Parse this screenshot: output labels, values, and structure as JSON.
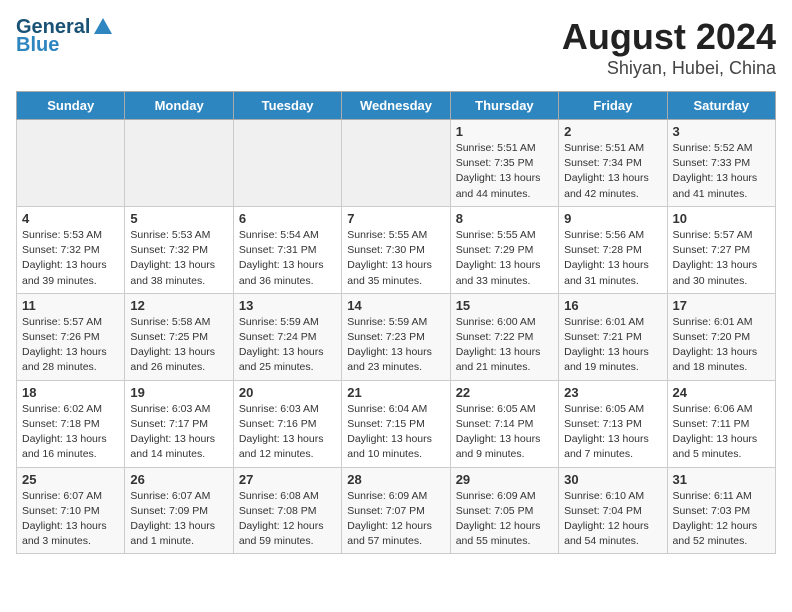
{
  "header": {
    "logo_line1": "General",
    "logo_line2": "Blue",
    "month_year": "August 2024",
    "location": "Shiyan, Hubei, China"
  },
  "days_of_week": [
    "Sunday",
    "Monday",
    "Tuesday",
    "Wednesday",
    "Thursday",
    "Friday",
    "Saturday"
  ],
  "weeks": [
    [
      {
        "day": "",
        "info": ""
      },
      {
        "day": "",
        "info": ""
      },
      {
        "day": "",
        "info": ""
      },
      {
        "day": "",
        "info": ""
      },
      {
        "day": "1",
        "info": "Sunrise: 5:51 AM\nSunset: 7:35 PM\nDaylight: 13 hours\nand 44 minutes."
      },
      {
        "day": "2",
        "info": "Sunrise: 5:51 AM\nSunset: 7:34 PM\nDaylight: 13 hours\nand 42 minutes."
      },
      {
        "day": "3",
        "info": "Sunrise: 5:52 AM\nSunset: 7:33 PM\nDaylight: 13 hours\nand 41 minutes."
      }
    ],
    [
      {
        "day": "4",
        "info": "Sunrise: 5:53 AM\nSunset: 7:32 PM\nDaylight: 13 hours\nand 39 minutes."
      },
      {
        "day": "5",
        "info": "Sunrise: 5:53 AM\nSunset: 7:32 PM\nDaylight: 13 hours\nand 38 minutes."
      },
      {
        "day": "6",
        "info": "Sunrise: 5:54 AM\nSunset: 7:31 PM\nDaylight: 13 hours\nand 36 minutes."
      },
      {
        "day": "7",
        "info": "Sunrise: 5:55 AM\nSunset: 7:30 PM\nDaylight: 13 hours\nand 35 minutes."
      },
      {
        "day": "8",
        "info": "Sunrise: 5:55 AM\nSunset: 7:29 PM\nDaylight: 13 hours\nand 33 minutes."
      },
      {
        "day": "9",
        "info": "Sunrise: 5:56 AM\nSunset: 7:28 PM\nDaylight: 13 hours\nand 31 minutes."
      },
      {
        "day": "10",
        "info": "Sunrise: 5:57 AM\nSunset: 7:27 PM\nDaylight: 13 hours\nand 30 minutes."
      }
    ],
    [
      {
        "day": "11",
        "info": "Sunrise: 5:57 AM\nSunset: 7:26 PM\nDaylight: 13 hours\nand 28 minutes."
      },
      {
        "day": "12",
        "info": "Sunrise: 5:58 AM\nSunset: 7:25 PM\nDaylight: 13 hours\nand 26 minutes."
      },
      {
        "day": "13",
        "info": "Sunrise: 5:59 AM\nSunset: 7:24 PM\nDaylight: 13 hours\nand 25 minutes."
      },
      {
        "day": "14",
        "info": "Sunrise: 5:59 AM\nSunset: 7:23 PM\nDaylight: 13 hours\nand 23 minutes."
      },
      {
        "day": "15",
        "info": "Sunrise: 6:00 AM\nSunset: 7:22 PM\nDaylight: 13 hours\nand 21 minutes."
      },
      {
        "day": "16",
        "info": "Sunrise: 6:01 AM\nSunset: 7:21 PM\nDaylight: 13 hours\nand 19 minutes."
      },
      {
        "day": "17",
        "info": "Sunrise: 6:01 AM\nSunset: 7:20 PM\nDaylight: 13 hours\nand 18 minutes."
      }
    ],
    [
      {
        "day": "18",
        "info": "Sunrise: 6:02 AM\nSunset: 7:18 PM\nDaylight: 13 hours\nand 16 minutes."
      },
      {
        "day": "19",
        "info": "Sunrise: 6:03 AM\nSunset: 7:17 PM\nDaylight: 13 hours\nand 14 minutes."
      },
      {
        "day": "20",
        "info": "Sunrise: 6:03 AM\nSunset: 7:16 PM\nDaylight: 13 hours\nand 12 minutes."
      },
      {
        "day": "21",
        "info": "Sunrise: 6:04 AM\nSunset: 7:15 PM\nDaylight: 13 hours\nand 10 minutes."
      },
      {
        "day": "22",
        "info": "Sunrise: 6:05 AM\nSunset: 7:14 PM\nDaylight: 13 hours\nand 9 minutes."
      },
      {
        "day": "23",
        "info": "Sunrise: 6:05 AM\nSunset: 7:13 PM\nDaylight: 13 hours\nand 7 minutes."
      },
      {
        "day": "24",
        "info": "Sunrise: 6:06 AM\nSunset: 7:11 PM\nDaylight: 13 hours\nand 5 minutes."
      }
    ],
    [
      {
        "day": "25",
        "info": "Sunrise: 6:07 AM\nSunset: 7:10 PM\nDaylight: 13 hours\nand 3 minutes."
      },
      {
        "day": "26",
        "info": "Sunrise: 6:07 AM\nSunset: 7:09 PM\nDaylight: 13 hours\nand 1 minute."
      },
      {
        "day": "27",
        "info": "Sunrise: 6:08 AM\nSunset: 7:08 PM\nDaylight: 12 hours\nand 59 minutes."
      },
      {
        "day": "28",
        "info": "Sunrise: 6:09 AM\nSunset: 7:07 PM\nDaylight: 12 hours\nand 57 minutes."
      },
      {
        "day": "29",
        "info": "Sunrise: 6:09 AM\nSunset: 7:05 PM\nDaylight: 12 hours\nand 55 minutes."
      },
      {
        "day": "30",
        "info": "Sunrise: 6:10 AM\nSunset: 7:04 PM\nDaylight: 12 hours\nand 54 minutes."
      },
      {
        "day": "31",
        "info": "Sunrise: 6:11 AM\nSunset: 7:03 PM\nDaylight: 12 hours\nand 52 minutes."
      }
    ]
  ]
}
